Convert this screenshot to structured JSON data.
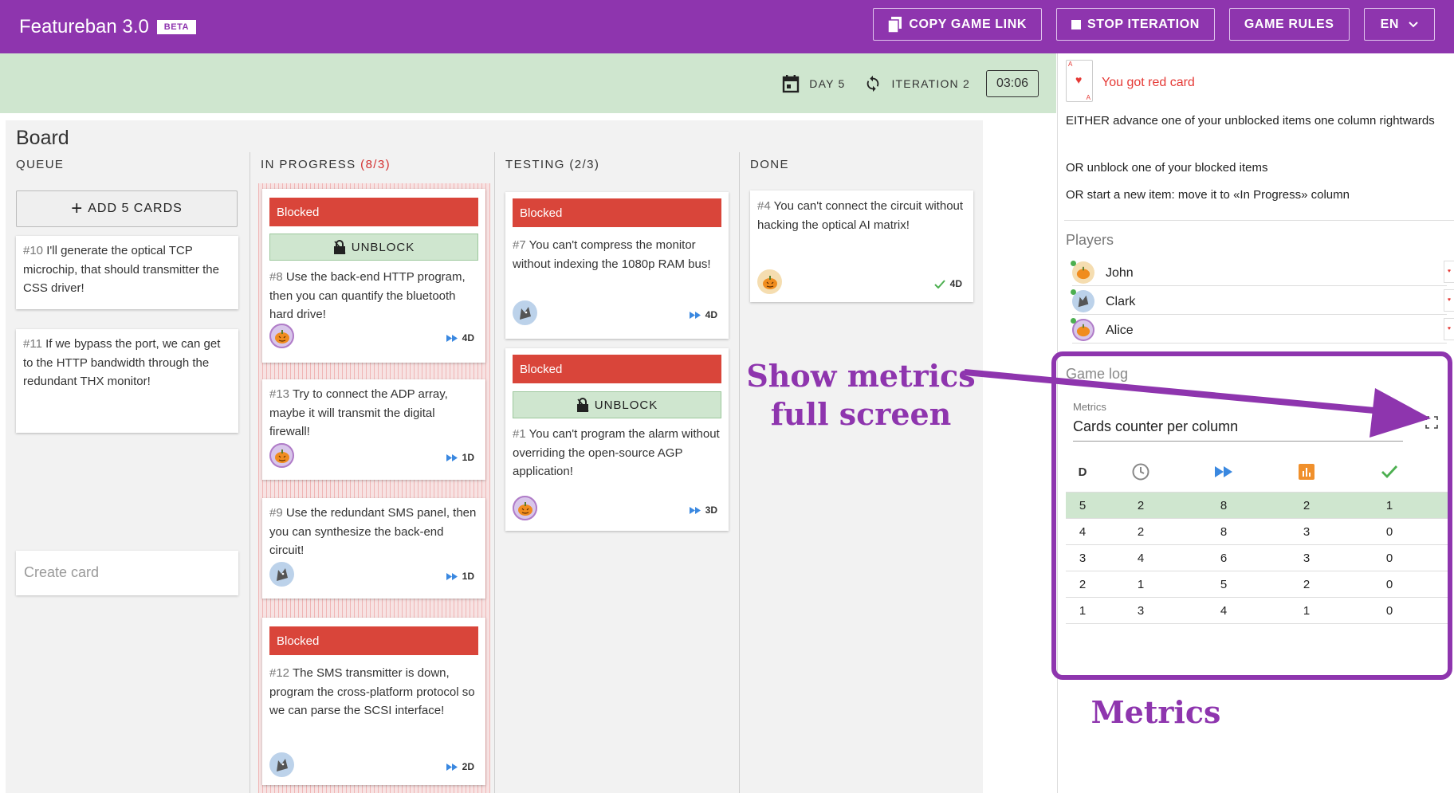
{
  "app": {
    "title": "Featureban 3.0",
    "badge": "BETA"
  },
  "topbar": {
    "copy_link": "COPY GAME LINK",
    "stop_iteration": "STOP ITERATION",
    "game_rules": "GAME RULES",
    "language": "EN"
  },
  "status": {
    "day": "DAY 5",
    "iteration": "ITERATION 2",
    "timer": "03:06"
  },
  "board": {
    "title": "Board",
    "columns": {
      "queue": "QUEUE",
      "in_progress": "IN PROGRESS",
      "in_progress_wip": "(8/3)",
      "testing": "TESTING (2/3)",
      "done": "DONE"
    },
    "add_cards": "ADD 5 CARDS",
    "create_card": "Create card",
    "blocked_label": "Blocked",
    "unblock_label": "UNBLOCK",
    "queue_cards": [
      {
        "num": "#10",
        "text": "I'll generate the optical TCP microchip, that should transmitter the CSS driver!"
      },
      {
        "num": "#11",
        "text": "If we bypass the port, we can get to the HTTP bandwidth through the redundant THX monitor!"
      }
    ],
    "in_progress_cards": [
      {
        "num": "#8",
        "text": "Use the back-end HTTP program, then you can quantify the bluetooth hard drive!",
        "days": "4D"
      },
      {
        "num": "#13",
        "text": "Try to connect the ADP array, maybe it will transmit the digital firewall!",
        "days": "1D"
      },
      {
        "num": "#9",
        "text": "Use the redundant SMS panel, then you can synthesize the back-end circuit!",
        "days": "1D"
      },
      {
        "num": "#12",
        "text": "The SMS transmitter is down, program the cross-platform protocol so we can parse the SCSI interface!",
        "days": "2D"
      }
    ],
    "testing_cards": [
      {
        "num": "#7",
        "text": "You can't compress the monitor without indexing the 1080p RAM bus!",
        "days": "4D"
      },
      {
        "num": "#1",
        "text": "You can't program the alarm without overriding the open-source AGP application!",
        "days": "3D"
      }
    ],
    "done_cards": [
      {
        "num": "#4",
        "text": "You can't connect the circuit without hacking the optical AI matrix!",
        "days": "4D"
      }
    ]
  },
  "sidebar": {
    "red_card_title": "You got red card",
    "rules": [
      "EITHER advance one of your unblocked items one column rightwards",
      "OR unblock one of your blocked items",
      "OR start a new item: move it to «In Progress» column"
    ],
    "players_title": "Players",
    "players": [
      {
        "name": "John",
        "avatar": "pumpkin"
      },
      {
        "name": "Clark",
        "avatar": "wolf"
      },
      {
        "name": "Alice",
        "avatar": "pumpkin"
      }
    ],
    "game_log_title": "Game log",
    "metrics_label": "Metrics",
    "metrics_selected": "Cards counter per column",
    "table_header_day": "D",
    "table_header_icons": [
      "clock-icon",
      "fast-forward-icon",
      "bar-chart-icon",
      "check-icon"
    ],
    "table_rows": [
      [
        "5",
        "2",
        "8",
        "2",
        "1"
      ],
      [
        "4",
        "2",
        "8",
        "3",
        "0"
      ],
      [
        "3",
        "4",
        "6",
        "3",
        "0"
      ],
      [
        "2",
        "1",
        "5",
        "2",
        "0"
      ],
      [
        "1",
        "3",
        "4",
        "1",
        "0"
      ]
    ]
  },
  "annotations": {
    "show_metrics": "Show metrics full screen",
    "metrics": "Metrics"
  },
  "colors": {
    "brand": "#8e35ae",
    "blocked": "#d9453a",
    "success_bg": "#cfe6cf",
    "red": "#e53935"
  }
}
